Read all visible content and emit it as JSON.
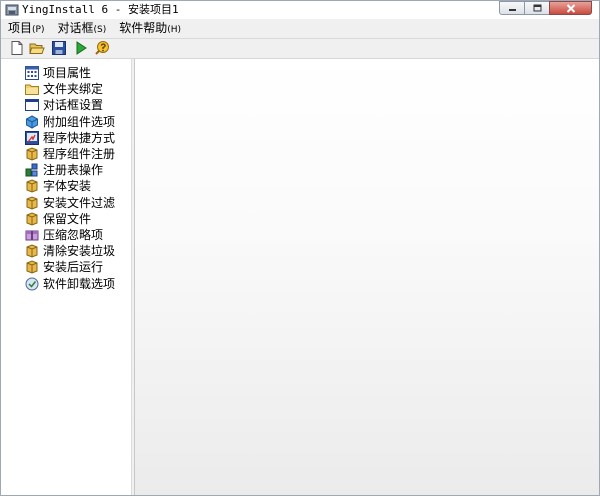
{
  "window": {
    "title": "YingInstall 6 - 安装项目1"
  },
  "menubar": {
    "items": [
      {
        "label": "项目",
        "accel": "(P)"
      },
      {
        "label": "对话框",
        "accel": "(S)"
      },
      {
        "label": "软件帮助",
        "accel": "(H)"
      }
    ]
  },
  "toolbar": {
    "buttons": [
      {
        "icon": "new-document-icon"
      },
      {
        "icon": "open-folder-icon"
      },
      {
        "icon": "save-disk-icon"
      },
      {
        "icon": "run-play-icon"
      },
      {
        "icon": "help-icon"
      }
    ]
  },
  "tree": {
    "items": [
      {
        "label": "项目属性",
        "icon": "project-properties-icon"
      },
      {
        "label": "文件夹绑定",
        "icon": "folder-icon"
      },
      {
        "label": "对话框设置",
        "icon": "dialog-window-icon"
      },
      {
        "label": "附加组件选项",
        "icon": "addon-component-icon"
      },
      {
        "label": "程序快捷方式",
        "icon": "shortcut-icon"
      },
      {
        "label": "程序组件注册",
        "icon": "component-register-icon"
      },
      {
        "label": "注册表操作",
        "icon": "registry-icon"
      },
      {
        "label": "字体安装",
        "icon": "font-install-icon"
      },
      {
        "label": "安装文件过滤",
        "icon": "file-filter-icon"
      },
      {
        "label": "保留文件",
        "icon": "keep-file-icon"
      },
      {
        "label": "压缩忽略项",
        "icon": "compress-ignore-icon"
      },
      {
        "label": "清除安装垃圾",
        "icon": "clean-junk-icon"
      },
      {
        "label": "安装后运行",
        "icon": "run-after-install-icon"
      },
      {
        "label": "软件卸载选项",
        "icon": "uninstall-options-icon"
      }
    ]
  }
}
